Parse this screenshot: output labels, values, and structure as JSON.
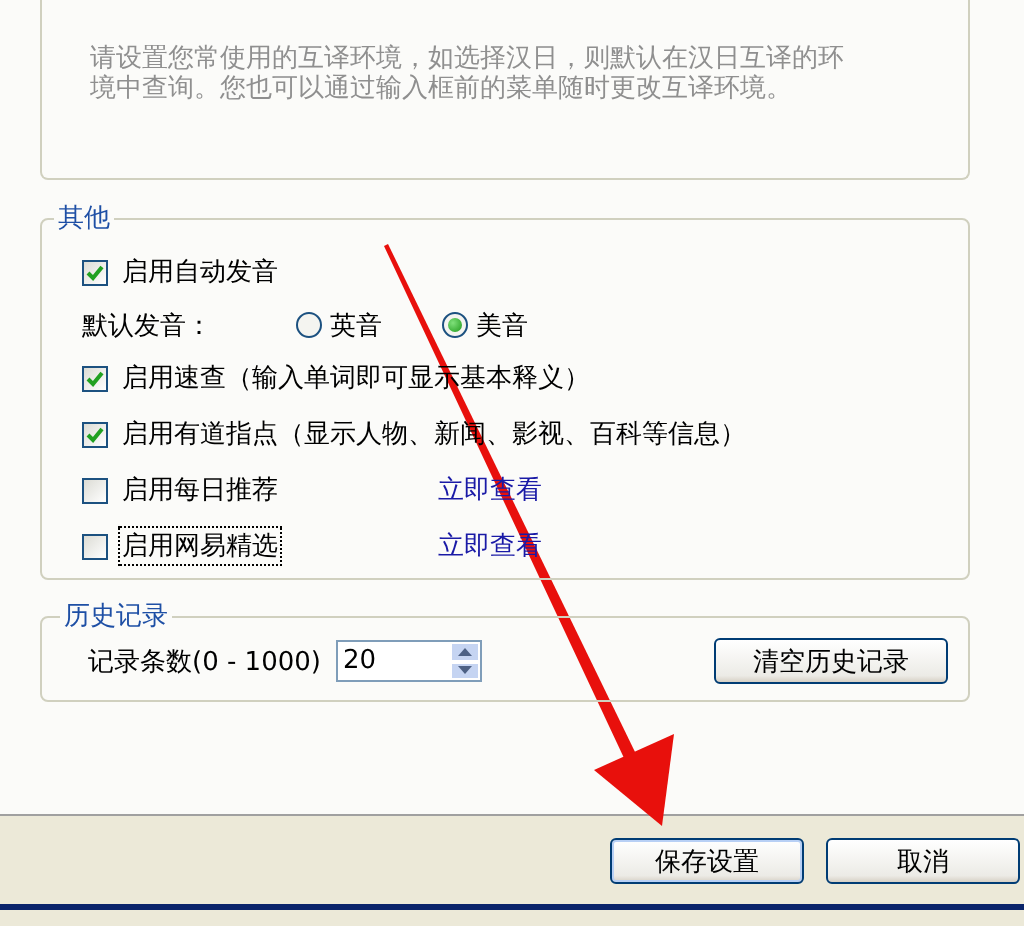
{
  "intro_text": "请设置您常使用的互译环境，如选择汉日，则默认在汉日互译的环境中查询。您也可以通过输入框前的菜单随时更改互译环境。",
  "other_group": {
    "title": "其他",
    "items": [
      {
        "kind": "checkbox",
        "label": "启用自动发音",
        "checked": true,
        "focused": false
      },
      {
        "kind": "radio_group",
        "label": "默认发音：",
        "options": [
          {
            "label": "英音",
            "selected": false
          },
          {
            "label": "美音",
            "selected": true
          }
        ]
      },
      {
        "kind": "checkbox",
        "label": "启用速查（输入单词即可显示基本释义）",
        "checked": true,
        "focused": false
      },
      {
        "kind": "checkbox",
        "label": "启用有道指点（显示人物、新闻、影视、百科等信息）",
        "checked": true,
        "focused": false
      },
      {
        "kind": "checkbox",
        "label": "启用每日推荐",
        "checked": false,
        "focused": false,
        "link": "立即查看"
      },
      {
        "kind": "checkbox",
        "label": "启用网易精选",
        "checked": false,
        "focused": true,
        "link": "立即查看"
      }
    ]
  },
  "history_group": {
    "title": "历史记录",
    "count_label": "记录条数(0 - 1000)",
    "count_value": "20",
    "clear_button": "清空历史记录"
  },
  "buttons": [
    {
      "label": "保存设置",
      "default": true
    },
    {
      "label": "取消",
      "default": false
    }
  ]
}
